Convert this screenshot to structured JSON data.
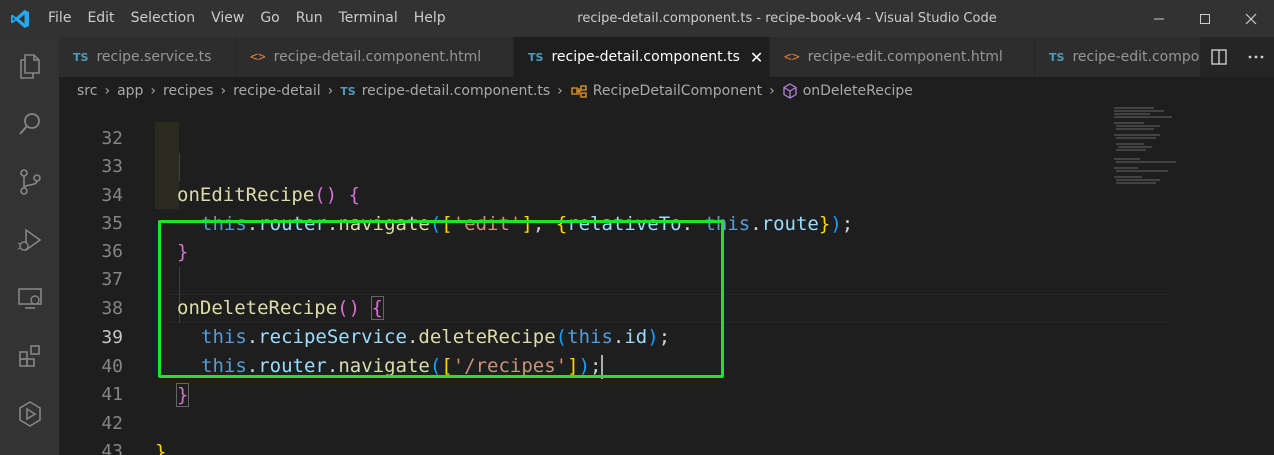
{
  "menu": [
    "File",
    "Edit",
    "Selection",
    "View",
    "Go",
    "Run",
    "Terminal",
    "Help"
  ],
  "window_title": "recipe-detail.component.ts - recipe-book-v4 - Visual Studio Code",
  "tabs": [
    {
      "badge": "TS",
      "label": "recipe.service.ts"
    },
    {
      "badge": "<>",
      "label": "recipe-detail.component.html"
    },
    {
      "badge": "TS",
      "label": "recipe-detail.component.ts",
      "close": "✕"
    },
    {
      "badge": "<>",
      "label": "recipe-edit.component.html"
    },
    {
      "badge": "TS",
      "label": "recipe-edit.compo"
    }
  ],
  "breadcrumb": {
    "src": "src",
    "app": "app",
    "recipes": "recipes",
    "folder": "recipe-detail",
    "file_badge": "TS",
    "file": "recipe-detail.component.ts",
    "class": "RecipeDetailComponent",
    "method": "onDeleteRecipe"
  },
  "code": {
    "line_numbers": [
      "32",
      "33",
      "34",
      "35",
      "36",
      "37",
      "38",
      "39",
      "40",
      "41",
      "42",
      "43"
    ],
    "l33_name": "onEditRecipe",
    "l34_this": "this",
    "l34_router": "router",
    "l34_navigate": "navigate",
    "l34_str": "'edit'",
    "l34_prop": "relativeTo",
    "l34_this2": "this",
    "l34_route": "route",
    "l37_name": "onDeleteRecipe",
    "l38_this": "this",
    "l38_service": "recipeService",
    "l38_method": "deleteRecipe",
    "l38_this2": "this",
    "l38_id": "id",
    "l39_this": "this",
    "l39_router": "router",
    "l39_navigate": "navigate",
    "l39_str": "'/recipes'"
  },
  "colors": {
    "highlight_box": "#22e32b",
    "accent": "#007acc"
  }
}
